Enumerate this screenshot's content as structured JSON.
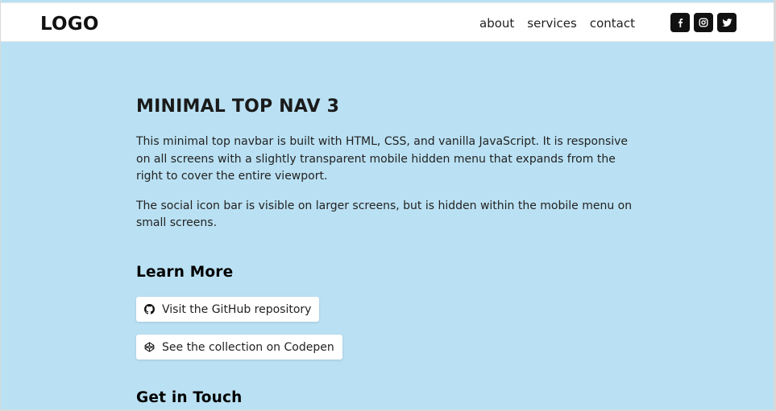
{
  "header": {
    "logo": "LOGO",
    "nav": [
      {
        "label": "about"
      },
      {
        "label": "services"
      },
      {
        "label": "contact"
      }
    ],
    "social_icons": [
      "facebook-icon",
      "instagram-icon",
      "twitter-icon"
    ]
  },
  "main": {
    "title": "MINIMAL TOP NAV 3",
    "paragraph1": "This minimal top navbar is built with HTML, CSS, and vanilla JavaScript. It is responsive on all screens with a slightly transparent mobile hidden menu that expands from the right to cover the entire viewport.",
    "paragraph2": "The social icon bar is visible on larger screens, but is hidden within the mobile menu on small screens.",
    "learn_more": {
      "heading": "Learn More",
      "github_label": "Visit the GitHub repository",
      "github_icon": "github-icon",
      "codepen_label": "See the collection on Codepen",
      "codepen_icon": "codepen-icon"
    },
    "get_in_touch": {
      "heading": "Get in Touch"
    }
  },
  "colors": {
    "page_background": "#bae1f3",
    "header_background": "#ffffff",
    "social_button": "#111111",
    "text": "#1a1a1a"
  }
}
